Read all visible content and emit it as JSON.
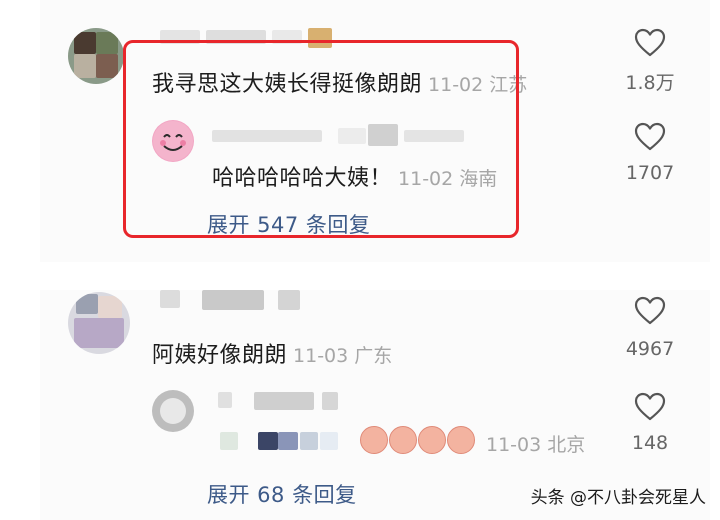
{
  "comments": [
    {
      "text": "我寻思这大姨长得挺像朗朗",
      "date": "11-02",
      "location": "江苏",
      "likes": "1.8万",
      "reply": {
        "text": "哈哈哈哈哈大姨！",
        "date": "11-02",
        "location": "海南",
        "likes": "1707"
      },
      "expand_label": "展开 547 条回复"
    },
    {
      "text": "阿姨好像朗朗",
      "date": "11-03",
      "location": "广东",
      "likes": "4967",
      "reply": {
        "date": "11-03",
        "location": "北京",
        "likes": "148",
        "emoji_count": 4
      },
      "expand_label": "展开 68 条回复"
    }
  ],
  "watermark": "头条 @不八卦会死星人",
  "icons": {
    "like": "heart-outline-icon"
  },
  "colors": {
    "highlight": "#e8262b",
    "link": "#3d5a88"
  }
}
